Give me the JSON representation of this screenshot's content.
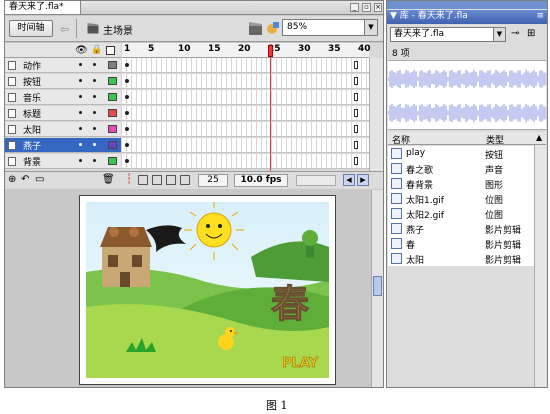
{
  "document_tab": {
    "title": "春天来了.fla*"
  },
  "toolbar": {
    "timeline_button": "时间轴",
    "scene_label": "主场景",
    "zoom_value": "85%"
  },
  "timeline": {
    "ruler_marks": [
      "1",
      "5",
      "10",
      "15",
      "20",
      "25",
      "30",
      "35",
      "40"
    ],
    "layers": [
      {
        "name": "动作",
        "color": "#7f7f7f",
        "selected": false
      },
      {
        "name": "按钮",
        "color": "#37c74d",
        "selected": false
      },
      {
        "name": "音乐",
        "color": "#37c74d",
        "selected": false
      },
      {
        "name": "标题",
        "color": "#e84a4a",
        "selected": false
      },
      {
        "name": "太阳",
        "color": "#e84ab8",
        "selected": false
      },
      {
        "name": "燕子",
        "color": "#6a42c8",
        "selected": true
      },
      {
        "name": "背景",
        "color": "#37c74d",
        "selected": false
      }
    ],
    "current_frame": "25",
    "frame_rate": "10.0 fps"
  },
  "stage": {
    "title_char": "春",
    "play_text": "PLAY"
  },
  "library": {
    "panel_title": "库 - 春天来了.fla",
    "selected_doc": "春天来了.fla",
    "item_count": "8 项",
    "col_name": "名称",
    "col_type": "类型",
    "items": [
      {
        "name": "play",
        "type": "按钮",
        "icon": "button-icon"
      },
      {
        "name": "春之歌",
        "type": "声音",
        "icon": "sound-icon"
      },
      {
        "name": "春背景",
        "type": "图形",
        "icon": "graphic-icon"
      },
      {
        "name": "太阳1.gif",
        "type": "位图",
        "icon": "bitmap-icon"
      },
      {
        "name": "太阳2.gif",
        "type": "位图",
        "icon": "bitmap-icon"
      },
      {
        "name": "燕子",
        "type": "影片剪辑",
        "icon": "movieclip-icon"
      },
      {
        "name": "春",
        "type": "影片剪辑",
        "icon": "movieclip-icon"
      },
      {
        "name": "太阳",
        "type": "影片剪辑",
        "icon": "movieclip-icon"
      }
    ]
  },
  "caption": "图 1"
}
